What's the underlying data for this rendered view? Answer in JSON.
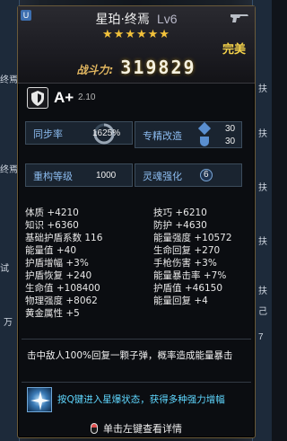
{
  "background": {
    "left_tags": [
      "终焉",
      "终焉",
      "试",
      "万"
    ],
    "right_tags": [
      "扶",
      "扶",
      "扶",
      "扶",
      "扶",
      "己",
      "7"
    ]
  },
  "tooltip": {
    "title": "星珀·终焉",
    "level": "Lv6",
    "stars": "★★★★★★",
    "grade": "完美",
    "power_label": "战斗力:",
    "power_value": "319829",
    "rank": "A+",
    "rank_sub": "2.10",
    "boxes": {
      "sync_label": "同步率",
      "sync_value": "1625%",
      "special_label": "专精改造",
      "special_value_1": "30",
      "special_value_2": "30",
      "reforge_label": "重构等级",
      "reforge_value": "1000",
      "soul_label": "灵魂强化",
      "soul_value": "6"
    },
    "stats": [
      {
        "name": "体质",
        "value": "+4210"
      },
      {
        "name": "技巧",
        "value": "+6210"
      },
      {
        "name": "知识",
        "value": "+6360"
      },
      {
        "name": "防护",
        "value": "+4630"
      },
      {
        "name": "基础护盾系数",
        "value": "116"
      },
      {
        "name": "能量强度",
        "value": "+10572"
      },
      {
        "name": "能量值",
        "value": "+40"
      },
      {
        "name": "生命回复",
        "value": "+270"
      },
      {
        "name": "护盾增幅",
        "value": "+3%"
      },
      {
        "name": "手枪伤害",
        "value": "+3%"
      },
      {
        "name": "护盾恢复",
        "value": "+240"
      },
      {
        "name": "能量暴击率",
        "value": "+7%"
      },
      {
        "name": "生命值",
        "value": "+108400"
      },
      {
        "name": "护盾值",
        "value": "+46150"
      },
      {
        "name": "物理强度",
        "value": "+8062"
      },
      {
        "name": "能量回复",
        "value": "+4"
      },
      {
        "name": "黄金属性",
        "value": "+5"
      }
    ],
    "description": "击中敌人100%回复一颗子弹，概率造成能量暴击",
    "skill_text": "按Q键进入星爆状态，获得多种强力增幅",
    "hint": "单击左键查看详情"
  },
  "colors": {
    "accent_gold": "#f3c23b",
    "skill_blue": "#5fd7ff",
    "label_blue": "#8cbcf0"
  }
}
